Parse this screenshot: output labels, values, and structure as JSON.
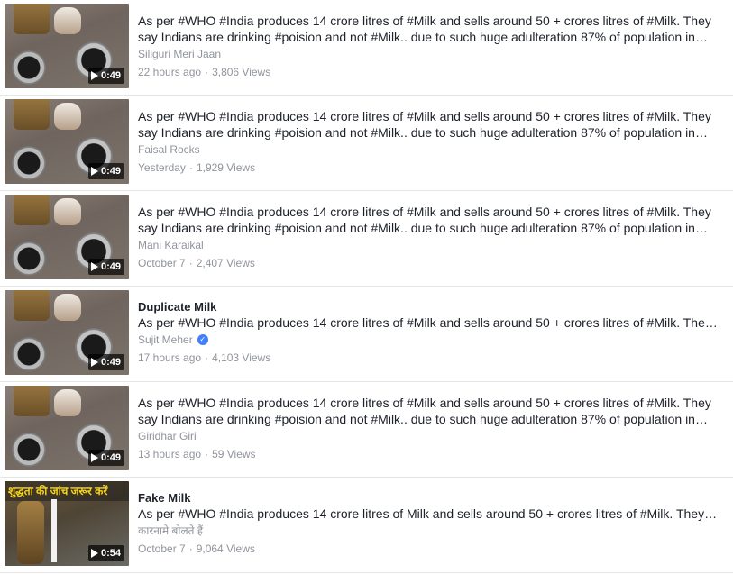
{
  "videos": [
    {
      "title": "",
      "description": "As per #WHO #India produces 14 crore litres of #Milk and sells around 50 + crores litres of #Milk. They say Indians are drinking #poision and not #Milk.. due to such huge adulteration 87% of population in…",
      "author": "Siliguri Meri Jaan",
      "verified": false,
      "time": "22 hours ago",
      "views": "3,806 Views",
      "duration": "0:49"
    },
    {
      "title": "",
      "description": "As per #WHO #India produces 14 crore litres of #Milk and sells around 50 + crores litres of #Milk. They say Indians are drinking #poision and not #Milk.. due to such huge adulteration 87% of population in…",
      "author": "Faisal Rocks",
      "verified": false,
      "time": "Yesterday",
      "views": "1,929 Views",
      "duration": "0:49"
    },
    {
      "title": "",
      "description": "As per #WHO #India produces 14 crore litres of #Milk and sells around 50 + crores litres of #Milk. They say Indians are drinking #poision and not #Milk.. due to such huge adulteration 87% of population in…",
      "author": "Mani Karaikal",
      "verified": false,
      "time": "October 7",
      "views": "2,407 Views",
      "duration": "0:49"
    },
    {
      "title": "Duplicate Milk",
      "description": "As per #WHO #India produces 14 crore litres of #Milk and sells around 50 + crores litres of #Milk. The…",
      "author": "Sujit Meher",
      "verified": true,
      "time": "17 hours ago",
      "views": "4,103 Views",
      "duration": "0:49"
    },
    {
      "title": "",
      "description": "As per #WHO #India produces 14 crore litres of #Milk and sells around 50 + crores litres of #Milk. They say Indians are drinking #poision and not #Milk.. due to such huge adulteration 87% of population in…",
      "author": "Giridhar Giri",
      "verified": false,
      "time": "13 hours ago",
      "views": "59 Views",
      "duration": "0:49"
    },
    {
      "title": "Fake Milk",
      "description": "As per #WHO #India produces 14 crore litres of Milk and sells around 50 + crores litres of #Milk. They…",
      "author": "कारनामे बोलते हैं",
      "verified": false,
      "time": "October 7",
      "views": "9,064 Views",
      "duration": "0:54",
      "thumb_banner": "शुद्धता की जांच जरूर करें"
    }
  ],
  "separator": "·",
  "play_icon": "play-triangle-icon",
  "verified_icon": "blue-check-badge-icon",
  "colors": {
    "meta": "#90949c",
    "text": "#1d2129",
    "verified": "#4080ff",
    "border": "#e5e5e5"
  }
}
